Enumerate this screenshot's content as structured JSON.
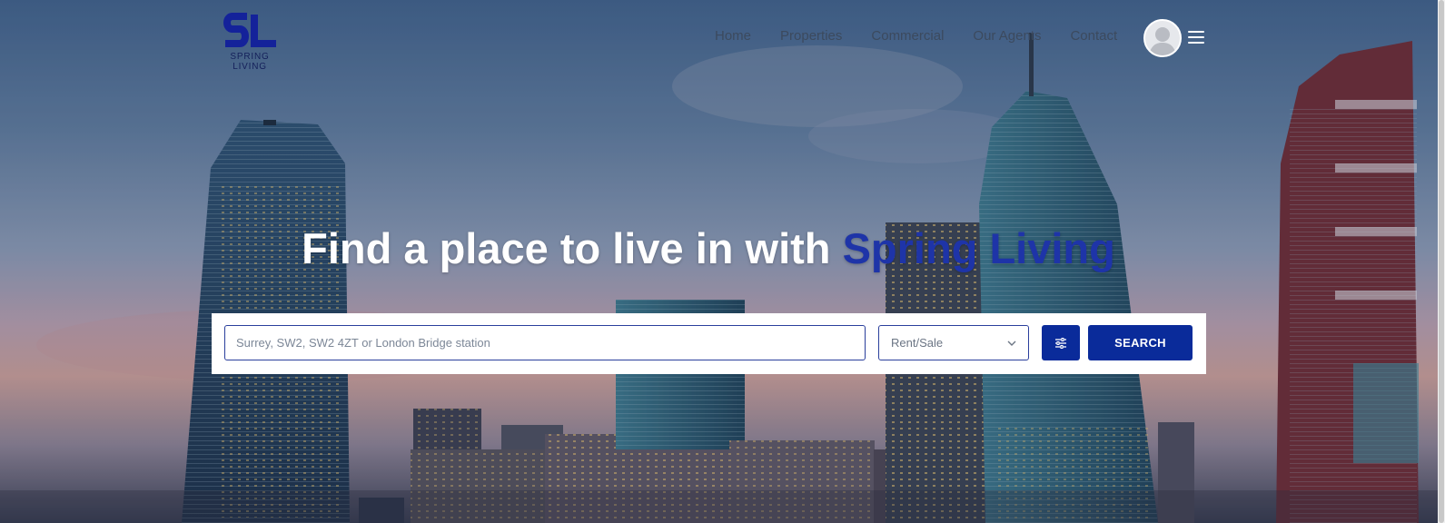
{
  "brand": {
    "logo_mark": "SL",
    "logo_text": "SPRING LIVING"
  },
  "nav": {
    "items": [
      "Home",
      "Properties",
      "Commercial",
      "Our Agents",
      "Contact"
    ]
  },
  "header_icons": {
    "avatar": "user-avatar-icon",
    "menu": "hamburger-menu-icon"
  },
  "hero": {
    "headline_prefix": "Find a place to live in with",
    "headline_accent": "Spring Living"
  },
  "search": {
    "placeholder": "Surrey, SW2, SW2 4ZT or London Bridge station",
    "value": "",
    "type_select": {
      "selected": "Rent/Sale"
    },
    "filter_icon": "sliders-icon",
    "submit_label": "SEARCH"
  },
  "colors": {
    "brand_blue": "#0a2b9a",
    "accent_text": "#1e34a8",
    "headline_text": "#ffffff"
  }
}
